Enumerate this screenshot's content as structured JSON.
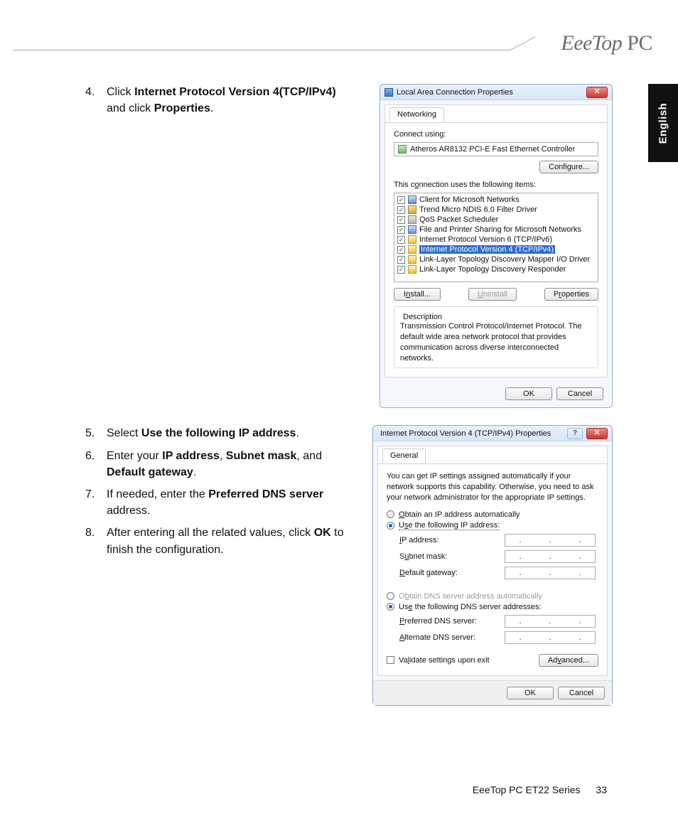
{
  "brand": "EeeTop PC",
  "language_tab": "English",
  "steps": {
    "s4_num": "4.",
    "s4_pre": "Click ",
    "s4_b1": "Internet Protocol Version 4(TCP/IPv4)",
    "s4_mid": " and click ",
    "s4_b2": "Properties",
    "s4_post": ".",
    "s5_num": "5.",
    "s5_pre": "Select ",
    "s5_b1": "Use the following IP address",
    "s5_post": ".",
    "s6_num": "6.",
    "s6_pre": "Enter your ",
    "s6_b1": "IP address",
    "s6_c1": ", ",
    "s6_b2": "Subnet mask",
    "s6_c2": ", and ",
    "s6_b3": "Default gateway",
    "s6_post": ".",
    "s7_num": "7.",
    "s7_pre": "If needed, enter the ",
    "s7_b1": "Preferred DNS server",
    "s7_post": " address.",
    "s8_num": "8.",
    "s8_pre": "After entering all the related values, click ",
    "s8_b1": "OK",
    "s8_post": " to finish the configuration."
  },
  "dlg1": {
    "title": "Local Area Connection Properties",
    "tab": "Networking",
    "connect_using": "Connect using:",
    "nic": "Atheros AR8132 PCI-E Fast Ethernet Controller",
    "configure": "Configure...",
    "uses_label": "This connection uses the following items:",
    "items": [
      "Client for Microsoft Networks",
      "Trend Micro NDIS 6.0 Filter Driver",
      "QoS Packet Scheduler",
      "File and Printer Sharing for Microsoft Networks",
      "Internet Protocol Version 6 (TCP/IPv6)",
      "Internet Protocol Version 4 (TCP/IPv4)",
      "Link-Layer Topology Discovery Mapper I/O Driver",
      "Link-Layer Topology Discovery Responder"
    ],
    "install": "Install...",
    "uninstall": "Uninstall",
    "properties": "Properties",
    "desc_title": "Description",
    "desc": "Transmission Control Protocol/Internet Protocol. The default wide area network protocol that provides communication across diverse interconnected networks.",
    "ok": "OK",
    "cancel": "Cancel"
  },
  "dlg2": {
    "title": "Internet Protocol Version 4 (TCP/IPv4) Properties",
    "tab": "General",
    "note": "You can get IP settings assigned automatically if your network supports this capability. Otherwise, you need to ask your network administrator for the appropriate IP settings.",
    "r1": "Obtain an IP address automatically",
    "r2": "Use the following IP address:",
    "ip": "IP address:",
    "mask": "Subnet mask:",
    "gw": "Default gateway:",
    "r3": "Obtain DNS server address automatically",
    "r4": "Use the following DNS server addresses:",
    "pdns": "Preferred DNS server:",
    "adns": "Alternate DNS server:",
    "validate": "Validate settings upon exit",
    "advanced": "Advanced...",
    "ok": "OK",
    "cancel": "Cancel"
  },
  "footer": {
    "series": "EeeTop PC ET22 Series",
    "page": "33"
  }
}
